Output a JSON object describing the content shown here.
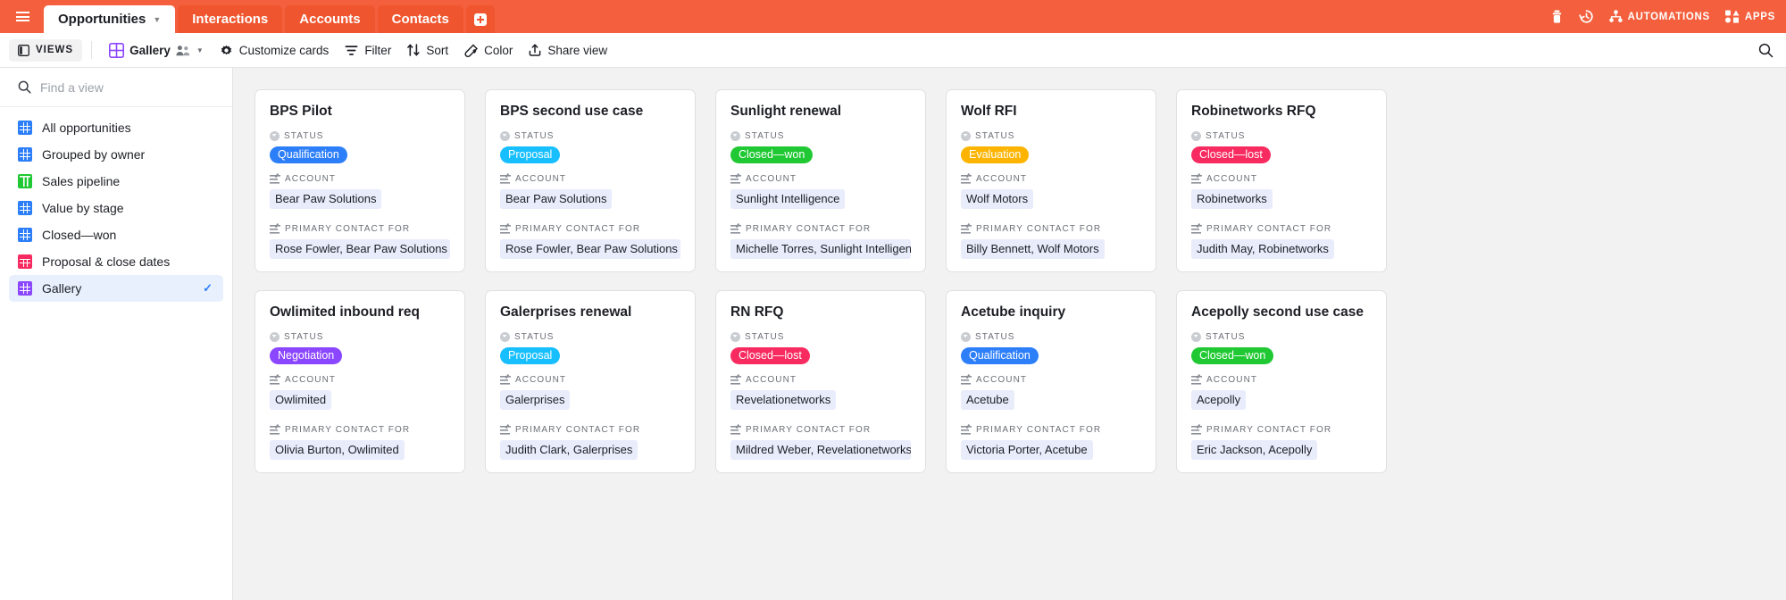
{
  "topbar": {
    "menu_icon": "hamburger-icon",
    "tabs": [
      {
        "label": "Opportunities",
        "active": true,
        "has_caret": true
      },
      {
        "label": "Interactions",
        "active": false,
        "has_caret": false
      },
      {
        "label": "Accounts",
        "active": false,
        "has_caret": false
      },
      {
        "label": "Contacts",
        "active": false,
        "has_caret": false
      }
    ],
    "add_tab_icon": "plus-icon",
    "right_items": [
      {
        "icon": "trash-icon",
        "label": ""
      },
      {
        "icon": "history-icon",
        "label": ""
      },
      {
        "icon": "automations-icon",
        "label": "AUTOMATIONS"
      },
      {
        "icon": "apps-icon",
        "label": "APPS"
      }
    ],
    "background_color": "#f4603e"
  },
  "toolbar": {
    "views_label": "VIEWS",
    "view_name": "Gallery",
    "customize_cards_label": "Customize cards",
    "filter_label": "Filter",
    "sort_label": "Sort",
    "color_label": "Color",
    "share_view_label": "Share view",
    "search_icon": "search-icon"
  },
  "sidebar": {
    "search": {
      "placeholder": "Find a view",
      "value": ""
    },
    "items": [
      {
        "label": "All opportunities",
        "icon": "grid-view-icon",
        "color": "blue",
        "selected": false
      },
      {
        "label": "Grouped by owner",
        "icon": "grid-view-icon",
        "color": "blue",
        "selected": false
      },
      {
        "label": "Sales pipeline",
        "icon": "kanban-view-icon",
        "color": "green",
        "selected": false
      },
      {
        "label": "Value by stage",
        "icon": "grid-view-icon",
        "color": "blue",
        "selected": false
      },
      {
        "label": "Closed—won",
        "icon": "grid-view-icon",
        "color": "blue",
        "selected": false
      },
      {
        "label": "Proposal & close dates",
        "icon": "calendar-view-icon",
        "color": "red",
        "selected": false
      },
      {
        "label": "Gallery",
        "icon": "gallery-view-icon",
        "color": "purple",
        "selected": true
      }
    ],
    "selected_check": "✓"
  },
  "gallery": {
    "field_labels": {
      "status": "STATUS",
      "account": "ACCOUNT",
      "primary_contact": "PRIMARY CONTACT FOR"
    },
    "status_colors": {
      "Qualification": "#2d7ff9",
      "Proposal": "#18bfff",
      "Closed—won": "#20c933",
      "Evaluation": "#fcb400",
      "Closed—lost": "#f82b60",
      "Negotiation": "#8b46ff"
    },
    "cards": [
      {
        "title": "BPS Pilot",
        "status": "Qualification",
        "account": "Bear Paw Solutions",
        "contact": "Rose Fowler, Bear Paw Solutions"
      },
      {
        "title": "BPS second use case",
        "status": "Proposal",
        "account": "Bear Paw Solutions",
        "contact": "Rose Fowler, Bear Paw Solutions"
      },
      {
        "title": "Sunlight renewal",
        "status": "Closed—won",
        "account": "Sunlight Intelligence",
        "contact": "Michelle Torres, Sunlight Intelligence"
      },
      {
        "title": "Wolf RFI",
        "status": "Evaluation",
        "account": "Wolf Motors",
        "contact": "Billy Bennett, Wolf Motors"
      },
      {
        "title": "Robinetworks RFQ",
        "status": "Closed—lost",
        "account": "Robinetworks",
        "contact": "Judith May, Robinetworks"
      },
      {
        "title": "Owlimited inbound req",
        "status": "Negotiation",
        "account": "Owlimited",
        "contact": "Olivia Burton, Owlimited"
      },
      {
        "title": "Galerprises renewal",
        "status": "Proposal",
        "account": "Galerprises",
        "contact": "Judith Clark, Galerprises"
      },
      {
        "title": "RN RFQ",
        "status": "Closed—lost",
        "account": "Revelationetworks",
        "contact": "Mildred Weber, Revelationetworks"
      },
      {
        "title": "Acetube inquiry",
        "status": "Qualification",
        "account": "Acetube",
        "contact": "Victoria Porter, Acetube"
      },
      {
        "title": "Acepolly second use case",
        "status": "Closed—won",
        "account": "Acepolly",
        "contact": "Eric Jackson, Acepolly"
      }
    ]
  }
}
